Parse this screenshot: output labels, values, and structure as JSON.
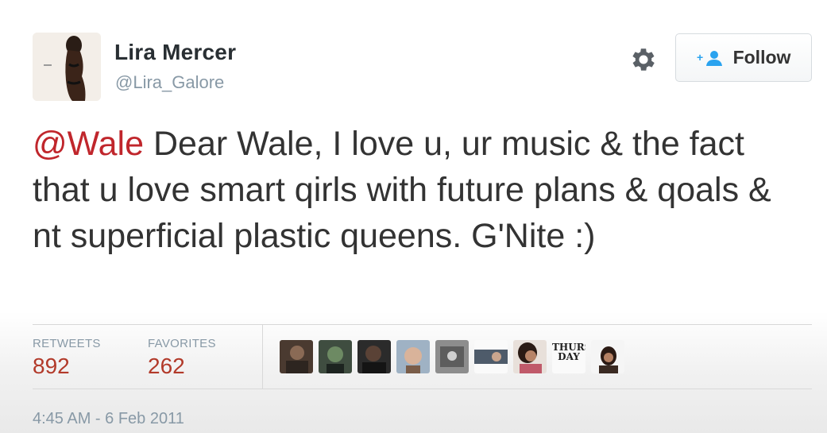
{
  "author": {
    "display_name": "Lira Mercer",
    "username": "@Lira_Galore"
  },
  "actions": {
    "settings_icon": "gear-icon",
    "follow_label": "Follow",
    "follow_icon": "add-user-icon"
  },
  "tweet": {
    "mention": "@Wale",
    "text": " Dear Wale, I love u, ur music & the fact that u love smart qirls with future plans & qoals & nt superficial plastic queens. G'Nite :)"
  },
  "stats": {
    "retweets_label": "RETWEETS",
    "retweets_count": "892",
    "favorites_label": "FAVORITES",
    "favorites_count": "262"
  },
  "favoriters": {
    "thumbnail_text": "THURS DAY"
  },
  "timestamp": "4:45 AM - 6 Feb 2011",
  "colors": {
    "mention": "#c0262c",
    "stat_value": "#b23a2a",
    "muted": "#8899a6",
    "follow_icon": "#2aa3ef"
  }
}
